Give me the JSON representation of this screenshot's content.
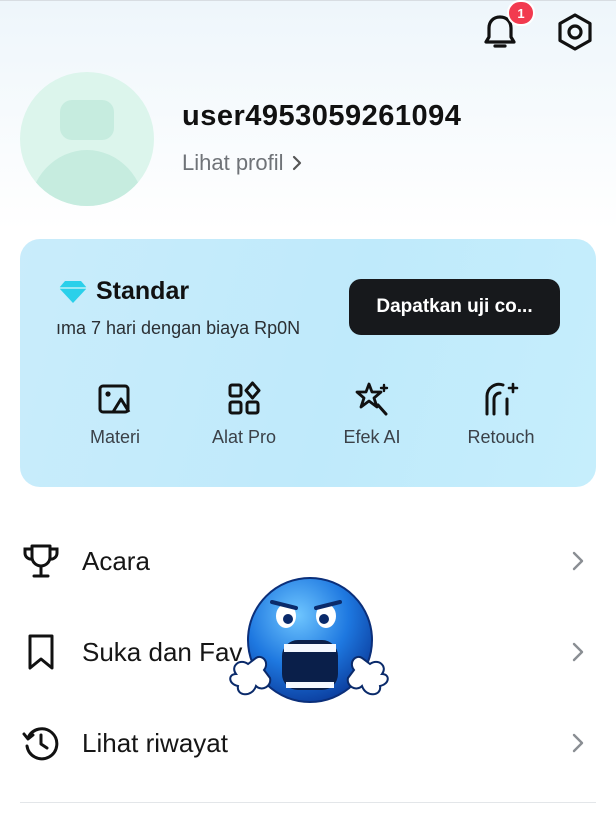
{
  "notifications": {
    "badge_count": "1"
  },
  "profile": {
    "username": "user4953059261094",
    "view_profile_label": "Lihat profil"
  },
  "premium": {
    "tier_name": "Standar",
    "description": "ıma 7 hari dengan biaya Rp0N",
    "cta_label": "Dapatkan uji co...",
    "features": [
      {
        "label": "Materi",
        "icon": "image-icon"
      },
      {
        "label": "Alat Pro",
        "icon": "pro-tools-icon"
      },
      {
        "label": "Efek AI",
        "icon": "ai-effects-icon"
      },
      {
        "label": "Retouch",
        "icon": "retouch-icon"
      }
    ]
  },
  "menu": [
    {
      "label": "Acara",
      "icon": "trophy-icon"
    },
    {
      "label": "Suka dan Fav",
      "icon": "bookmark-icon"
    },
    {
      "label": "Lihat riwayat",
      "icon": "history-icon"
    }
  ],
  "colors": {
    "accent_diamond": "#2ad0ea",
    "badge": "#f23a4f",
    "cta_bg": "#17191c",
    "card_bg": "#c4ecfb",
    "avatar_bg": "#dcf5ec"
  }
}
